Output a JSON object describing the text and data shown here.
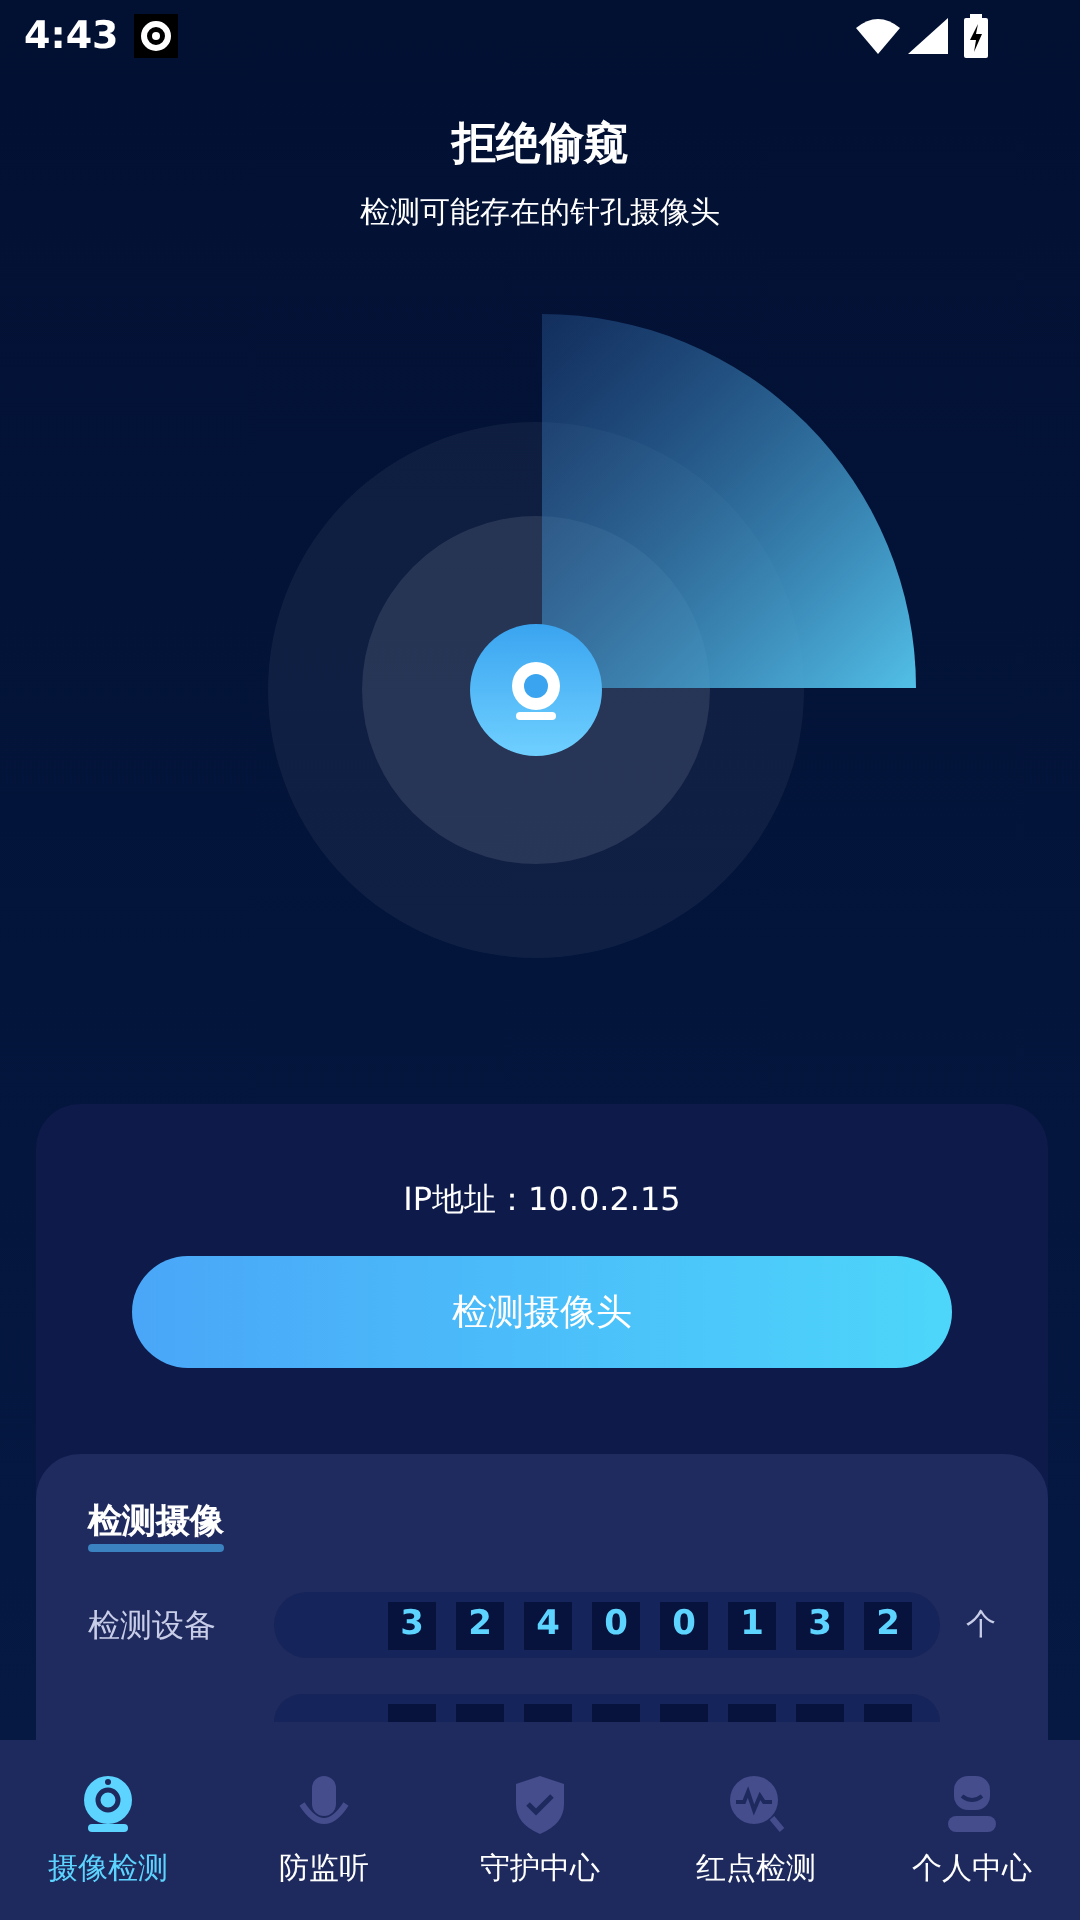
{
  "status_bar": {
    "time": "4:43"
  },
  "header": {
    "title": "拒绝偷窥",
    "subtitle": "检测可能存在的针孔摄像头"
  },
  "panel": {
    "ip": "IP地址：10.0.2.15",
    "scan_button": "检测摄像头"
  },
  "stats": {
    "title": "检测摄像",
    "rows": [
      {
        "label": "检测设备",
        "digits": [
          "3",
          "2",
          "4",
          "0",
          "0",
          "1",
          "3",
          "2"
        ],
        "unit": "个"
      }
    ]
  },
  "nav": [
    {
      "label": "摄像检测",
      "selected": true
    },
    {
      "label": "防监听",
      "selected": false
    },
    {
      "label": "守护中心",
      "selected": false
    },
    {
      "label": "红点检测",
      "selected": false
    },
    {
      "label": "个人中心",
      "selected": false
    }
  ]
}
